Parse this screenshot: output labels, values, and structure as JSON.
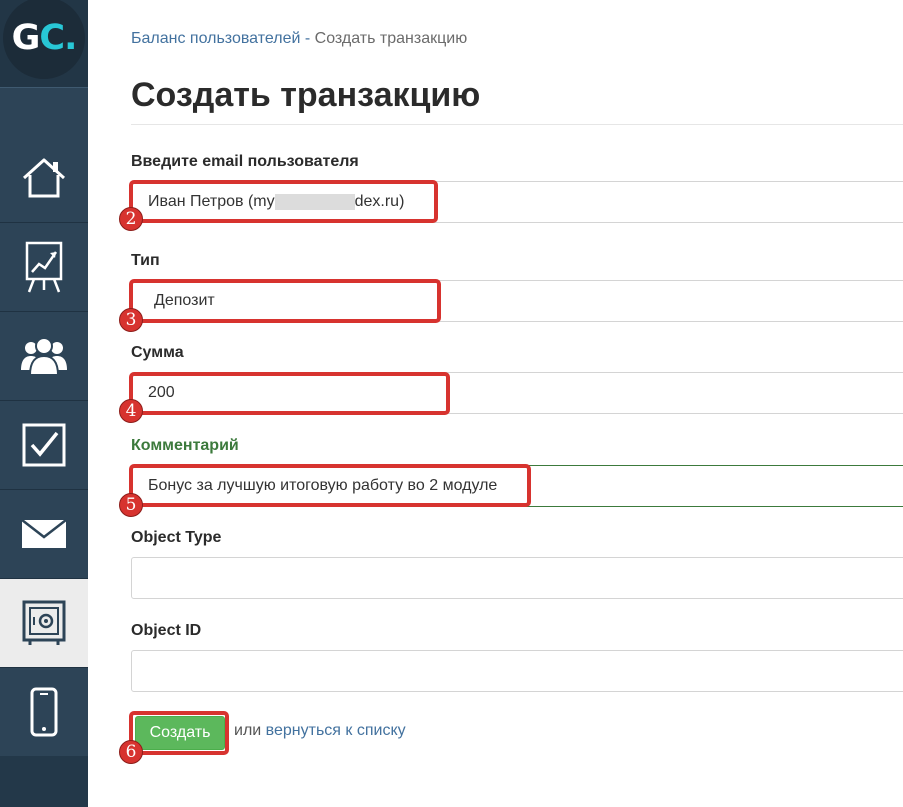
{
  "logo": {
    "g": "G",
    "c": "C",
    "dot": "."
  },
  "sidebar": {
    "items": [
      {
        "icon": "home-icon"
      },
      {
        "icon": "chart-board-icon"
      },
      {
        "icon": "users-icon"
      },
      {
        "icon": "checkbox-icon"
      },
      {
        "icon": "mail-icon"
      },
      {
        "icon": "safe-icon",
        "active": true
      },
      {
        "icon": "mobile-icon"
      }
    ]
  },
  "breadcrumb": {
    "parent": "Баланс пользователей -",
    "current": "Создать транзакцию"
  },
  "page_title": "Создать транзакцию",
  "form": {
    "email": {
      "label": "Введите email пользователя",
      "value_start": "Иван Петров (my",
      "value_end": "dex.ru)"
    },
    "type": {
      "label": "Тип",
      "value": "Депозит"
    },
    "amount": {
      "label": "Сумма",
      "value": "200"
    },
    "comment": {
      "label": "Комментарий",
      "value": "Бонус за лучшую итоговую работу во 2 модуле"
    },
    "object_type": {
      "label": "Object Type",
      "value": ""
    },
    "object_id": {
      "label": "Object ID",
      "value": ""
    }
  },
  "actions": {
    "submit": "Создать",
    "or": "или",
    "back_link": "вернуться к списку"
  },
  "annotations": [
    "2",
    "3",
    "4",
    "5",
    "6"
  ],
  "colors": {
    "accent_red": "#d7332f",
    "submit_green": "#5cb85c",
    "sidebar": "#2d4457",
    "link": "#43729f"
  }
}
